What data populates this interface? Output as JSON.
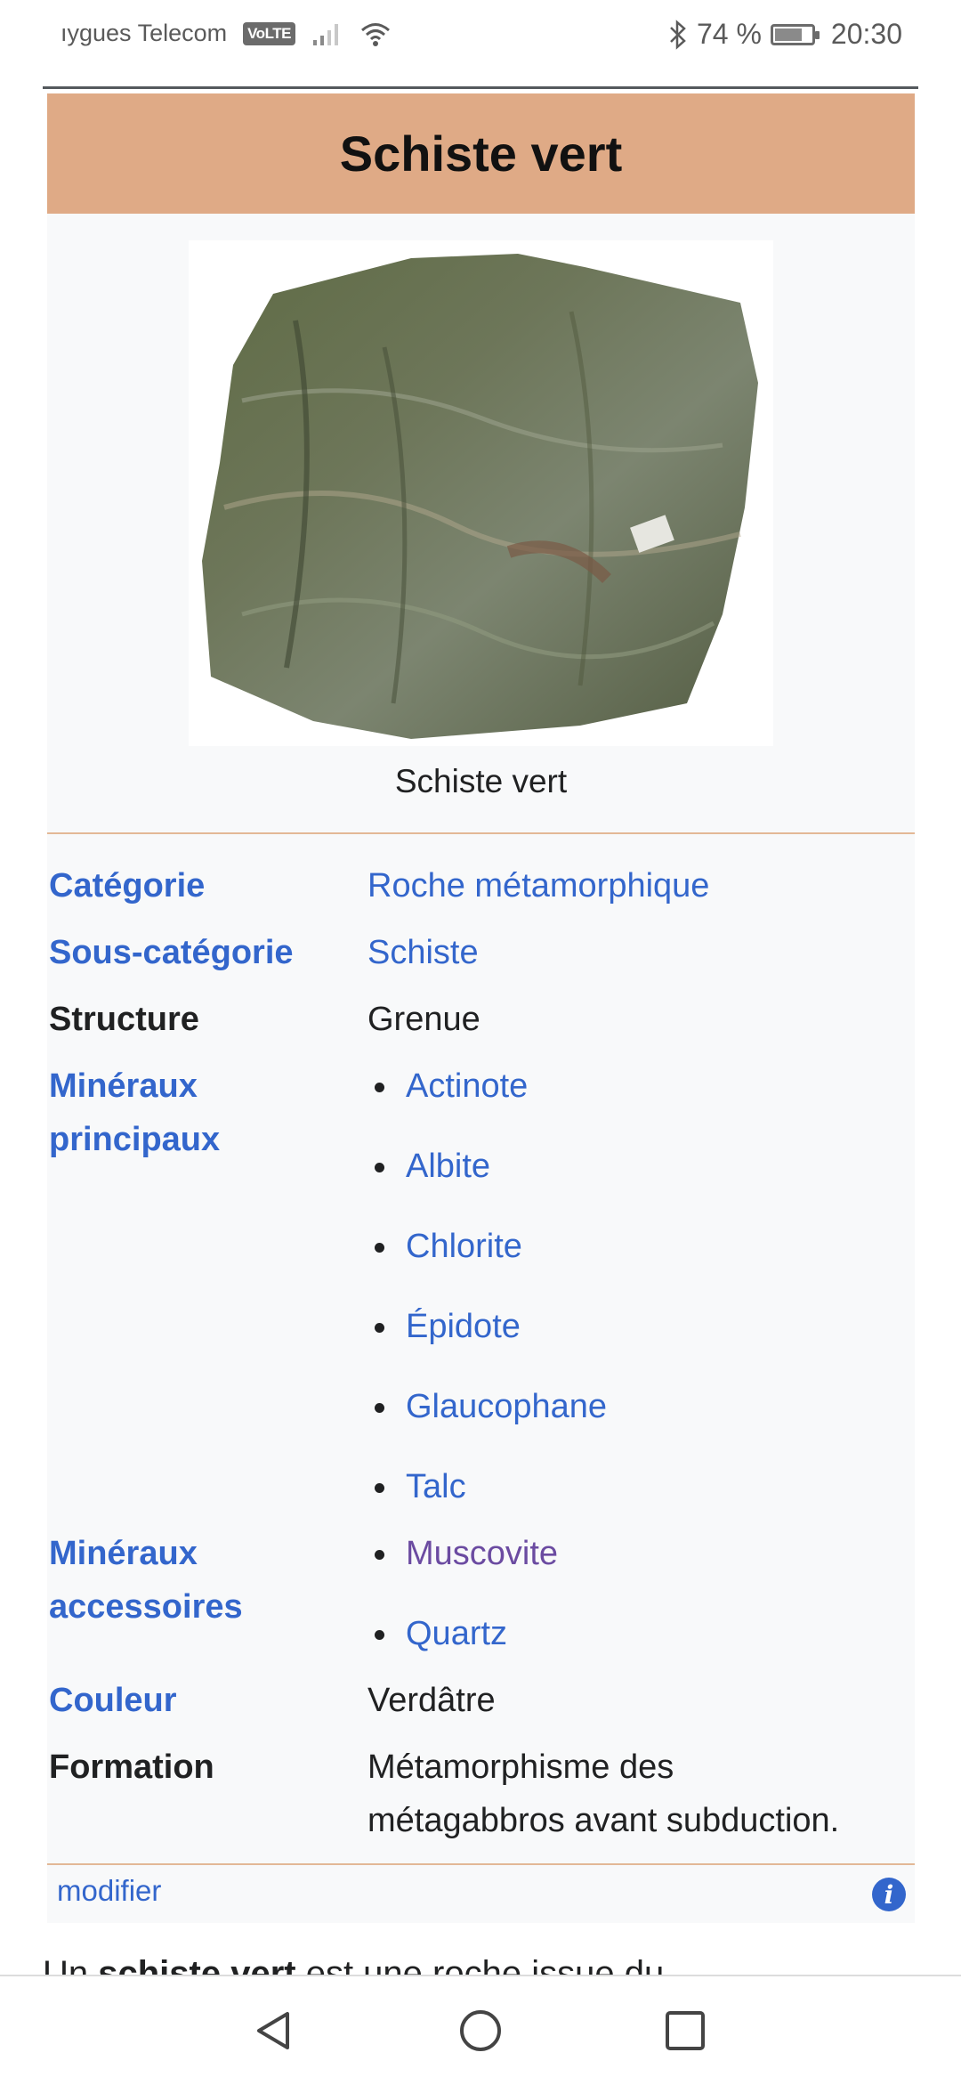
{
  "status_bar": {
    "carrier": "ıygues Telecom",
    "volte": "VoLTE",
    "battery": "74 %",
    "battery_level": 0.74,
    "time": "20:30"
  },
  "infobox": {
    "title": "Schiste vert",
    "image_caption": "Schiste vert",
    "rows": {
      "categorie": {
        "label": "Catégorie",
        "value": "Roche métamorphique"
      },
      "sous_categorie": {
        "label": "Sous-catégorie",
        "value": "Schiste"
      },
      "structure": {
        "label": "Structure",
        "value": "Grenue"
      },
      "mineraux_principaux": {
        "label_line1": "Minéraux",
        "label_line2": "principaux",
        "items": [
          "Actinote",
          "Albite",
          "Chlorite",
          "Épidote",
          "Glaucophane",
          "Talc"
        ]
      },
      "mineraux_accessoires": {
        "label_line1": "Minéraux",
        "label_line2": "accessoires",
        "items": [
          "Muscovite",
          "Quartz"
        ]
      },
      "couleur": {
        "label": "Couleur",
        "value": "Verdâtre"
      },
      "formation": {
        "label": "Formation",
        "value_line1": "Métamorphisme des",
        "value_line2": "métagabbros avant subduction."
      }
    },
    "footer": {
      "edit_link": "modifier",
      "info_glyph": "i"
    }
  },
  "article": {
    "intro_start": "Un ",
    "intro_bold": "schiste vert",
    "intro_rest": " est une roche issue du"
  },
  "colors": {
    "title_bar": "#dfaa86",
    "link": "#3366cc",
    "visited_link": "#6b4ba1",
    "infobox_bg": "#f8f9fa"
  },
  "icons": [
    "signal-icon",
    "wifi-icon",
    "bluetooth-icon",
    "battery-icon",
    "info-icon",
    "nav-back-icon",
    "nav-home-icon",
    "nav-recents-icon"
  ]
}
